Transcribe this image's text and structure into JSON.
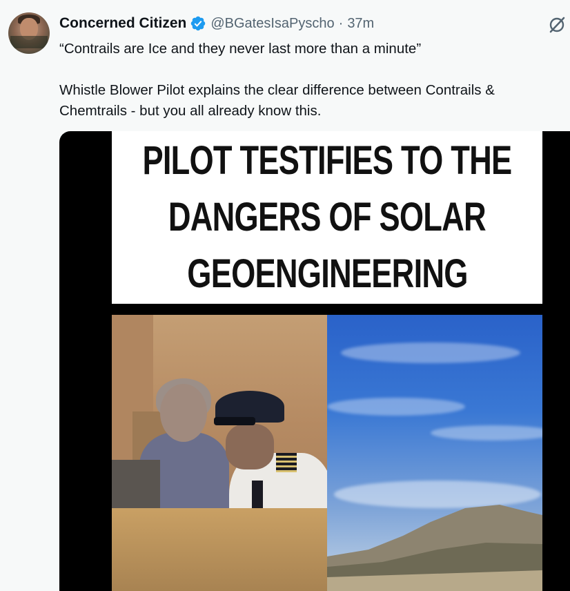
{
  "post": {
    "author_name": "Concerned Citizen",
    "handle": "@BGatesIsaPyscho",
    "separator": "·",
    "time_ago": "37m",
    "text_line1": "“Contrails are Ice and they never last more than a minute”",
    "text_line2": "Whistle Blower Pilot explains the clear difference between Contrails & Chemtrails - but you all already know this."
  },
  "media": {
    "banner_lines": [
      "PILOT TESTIFIES TO THE",
      "DANGERS OF SOLAR",
      "GEOENGINEERING"
    ]
  },
  "icons": {
    "verified": "verified-badge-icon",
    "grok": "grok-icon"
  },
  "colors": {
    "verified_blue": "#1d9bf0",
    "secondary_text": "#536471",
    "primary_text": "#0f1419",
    "background": "#f7f9f9"
  }
}
